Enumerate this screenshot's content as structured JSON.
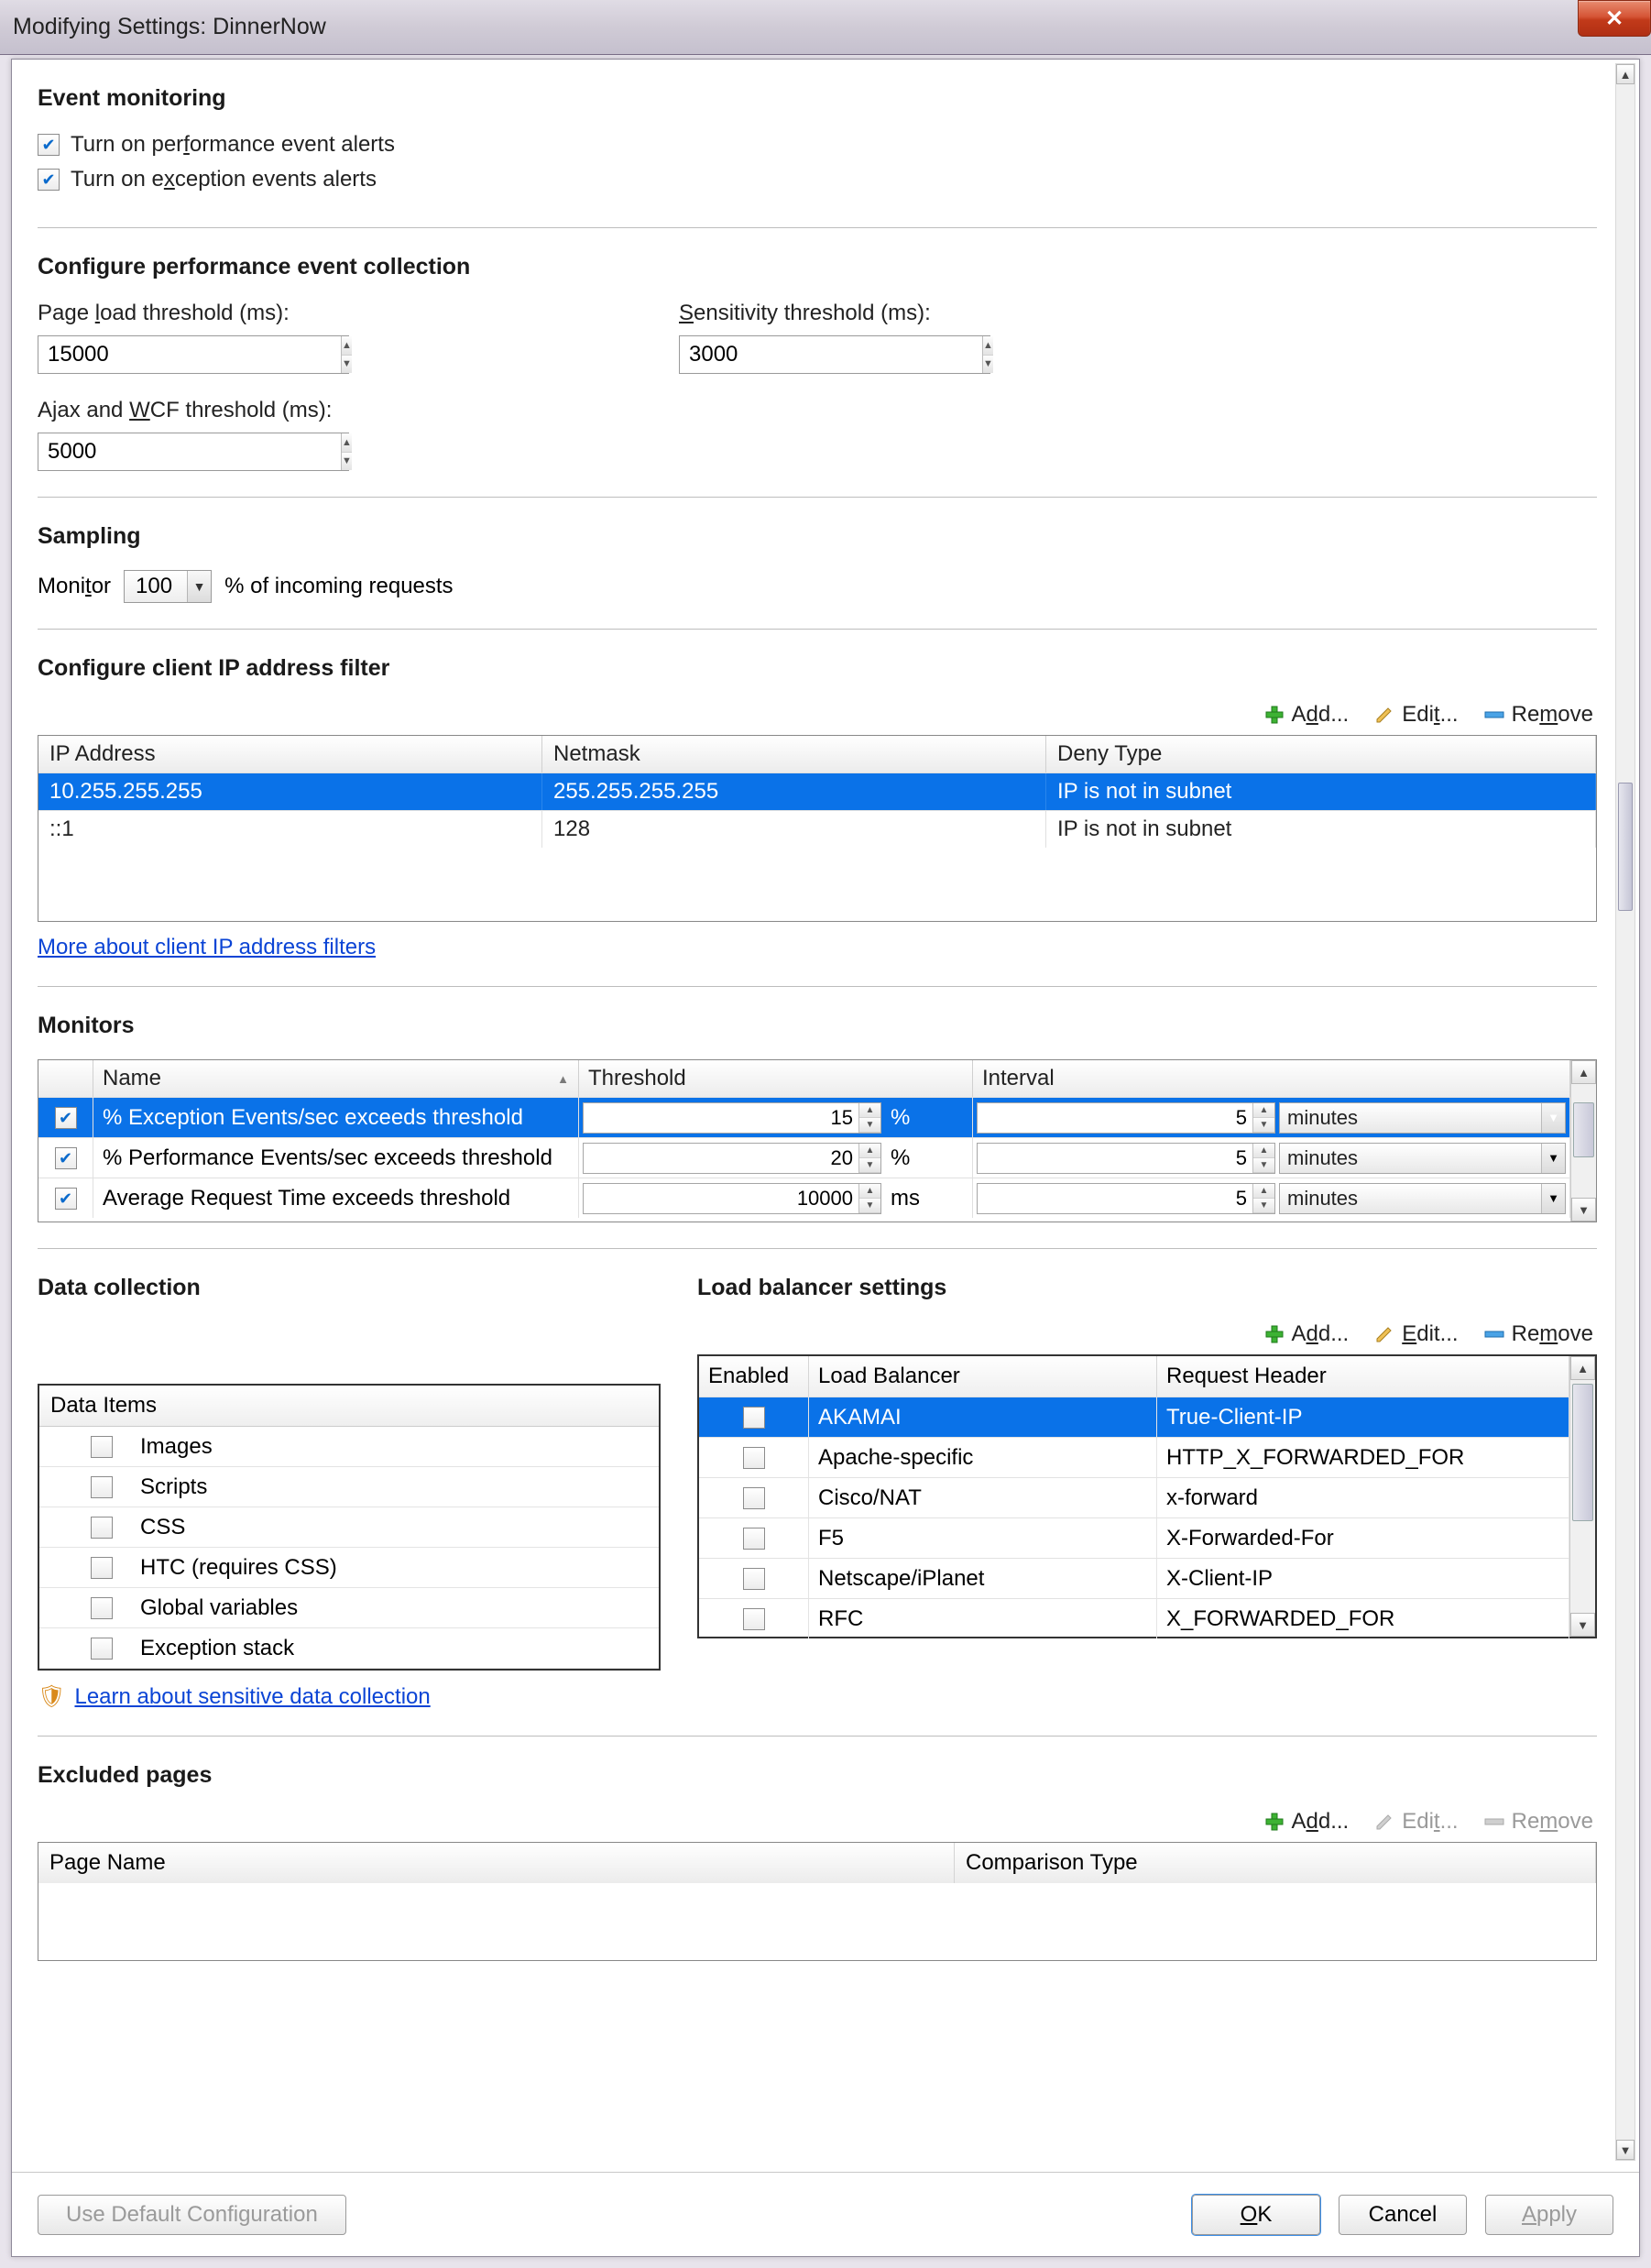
{
  "title": "Modifying Settings: DinnerNow",
  "event_monitoring": {
    "heading": "Event monitoring",
    "perf_alerts": "Turn on performance event alerts",
    "exc_alerts": "Turn on exception events alerts"
  },
  "perf_collection": {
    "heading": "Configure performance event collection",
    "page_load_label": "Page load threshold (ms):",
    "page_load_value": "15000",
    "sensitivity_label": "Sensitivity threshold (ms):",
    "sensitivity_value": "3000",
    "ajax_label": "Ajax and WCF threshold (ms):",
    "ajax_value": "5000"
  },
  "sampling": {
    "heading": "Sampling",
    "monitor_label": "Monitor",
    "monitor_value": "100",
    "suffix": "% of incoming requests"
  },
  "ip_filter": {
    "heading": "Configure client IP address filter",
    "add": "Add...",
    "edit": "Edit...",
    "remove": "Remove",
    "cols": {
      "ip": "IP Address",
      "netmask": "Netmask",
      "deny": "Deny Type"
    },
    "rows": [
      {
        "ip": "10.255.255.255",
        "netmask": "255.255.255.255",
        "deny": "IP is not in subnet",
        "selected": true
      },
      {
        "ip": "::1",
        "netmask": "128",
        "deny": "IP is not in subnet",
        "selected": false
      }
    ],
    "link": "More about client IP address filters"
  },
  "monitors_sec": {
    "heading": "Monitors",
    "cols": {
      "name": "Name",
      "threshold": "Threshold",
      "interval": "Interval"
    },
    "rows": [
      {
        "checked": true,
        "selected": true,
        "name": "% Exception Events/sec exceeds threshold",
        "threshold": "15",
        "unit": "%",
        "interval": "5",
        "interval_unit": "minutes"
      },
      {
        "checked": true,
        "selected": false,
        "name": "% Performance Events/sec exceeds threshold",
        "threshold": "20",
        "unit": "%",
        "interval": "5",
        "interval_unit": "minutes"
      },
      {
        "checked": true,
        "selected": false,
        "name": "Average Request Time exceeds threshold",
        "threshold": "10000",
        "unit": "ms",
        "interval": "5",
        "interval_unit": "minutes"
      }
    ]
  },
  "data_collection": {
    "heading": "Data collection",
    "col": "Data Items",
    "items": [
      "Images",
      "Scripts",
      "CSS",
      "HTC (requires CSS)",
      "Global variables",
      "Exception stack"
    ],
    "link": "Learn about sensitive data collection"
  },
  "load_balancer": {
    "heading": "Load balancer settings",
    "add": "Add...",
    "edit": "Edit...",
    "remove": "Remove",
    "cols": {
      "enabled": "Enabled",
      "lb": "Load Balancer",
      "rh": "Request Header"
    },
    "rows": [
      {
        "selected": true,
        "enabled": false,
        "lb": "AKAMAI",
        "rh": "True-Client-IP"
      },
      {
        "selected": false,
        "enabled": false,
        "lb": "Apache-specific",
        "rh": "HTTP_X_FORWARDED_FOR"
      },
      {
        "selected": false,
        "enabled": false,
        "lb": "Cisco/NAT",
        "rh": "x-forward"
      },
      {
        "selected": false,
        "enabled": false,
        "lb": "F5",
        "rh": "X-Forwarded-For"
      },
      {
        "selected": false,
        "enabled": false,
        "lb": "Netscape/iPlanet",
        "rh": "X-Client-IP"
      },
      {
        "selected": false,
        "enabled": false,
        "lb": "RFC",
        "rh": "X_FORWARDED_FOR"
      }
    ]
  },
  "excluded": {
    "heading": "Excluded pages",
    "add": "Add...",
    "edit": "Edit...",
    "remove": "Remove",
    "cols": {
      "page": "Page Name",
      "comp": "Comparison Type"
    }
  },
  "footer": {
    "default": "Use Default Configuration",
    "ok": "OK",
    "cancel": "Cancel",
    "apply": "Apply"
  }
}
